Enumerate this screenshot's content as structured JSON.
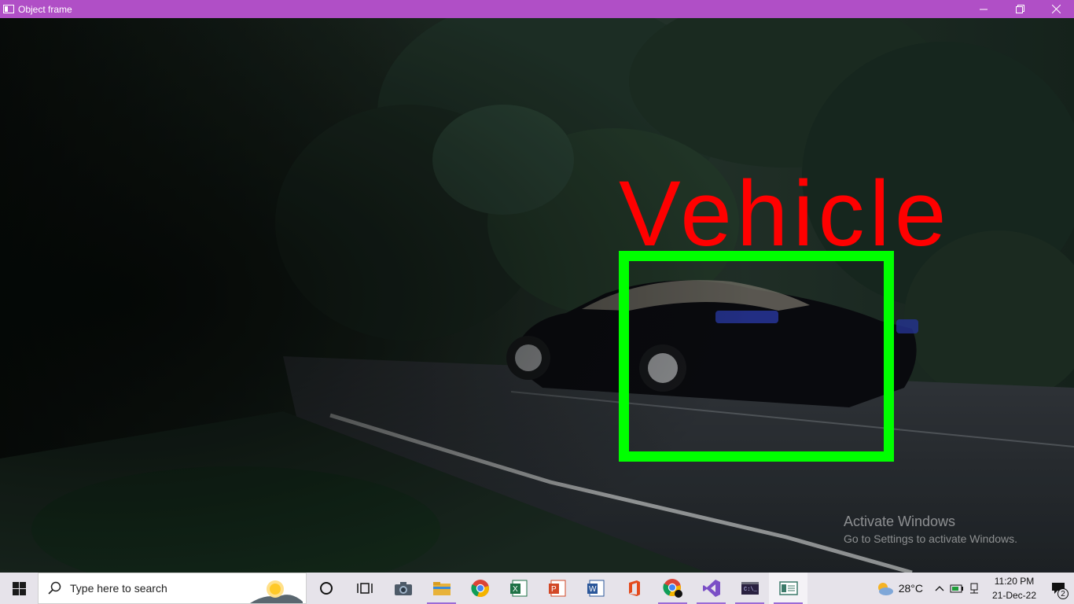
{
  "window": {
    "title": "Object frame",
    "controls": {
      "minimize_icon": "minimize-icon",
      "maximize_icon": "restore-icon",
      "close_icon": "close-icon"
    }
  },
  "frame": {
    "detection_label": "Vehicle",
    "box_color": "#00ff00",
    "label_color": "#ff0000"
  },
  "watermark": {
    "title": "Activate Windows",
    "subtitle": "Go to Settings to activate Windows."
  },
  "taskbar": {
    "search_placeholder": "Type here to search",
    "apps": [
      "cortana",
      "task-view",
      "camera",
      "file-explorer",
      "chrome",
      "excel",
      "powerpoint",
      "word",
      "office",
      "chrome-profile",
      "visual-studio",
      "terminal",
      "python-window"
    ],
    "weather": {
      "temp": "28°C"
    },
    "clock": {
      "time": "11:20 PM",
      "date": "21-Dec-22"
    },
    "notifications": {
      "count": "2"
    }
  },
  "colors": {
    "titlebar": "#b04fc6",
    "taskbar": "#e6e3ea"
  }
}
